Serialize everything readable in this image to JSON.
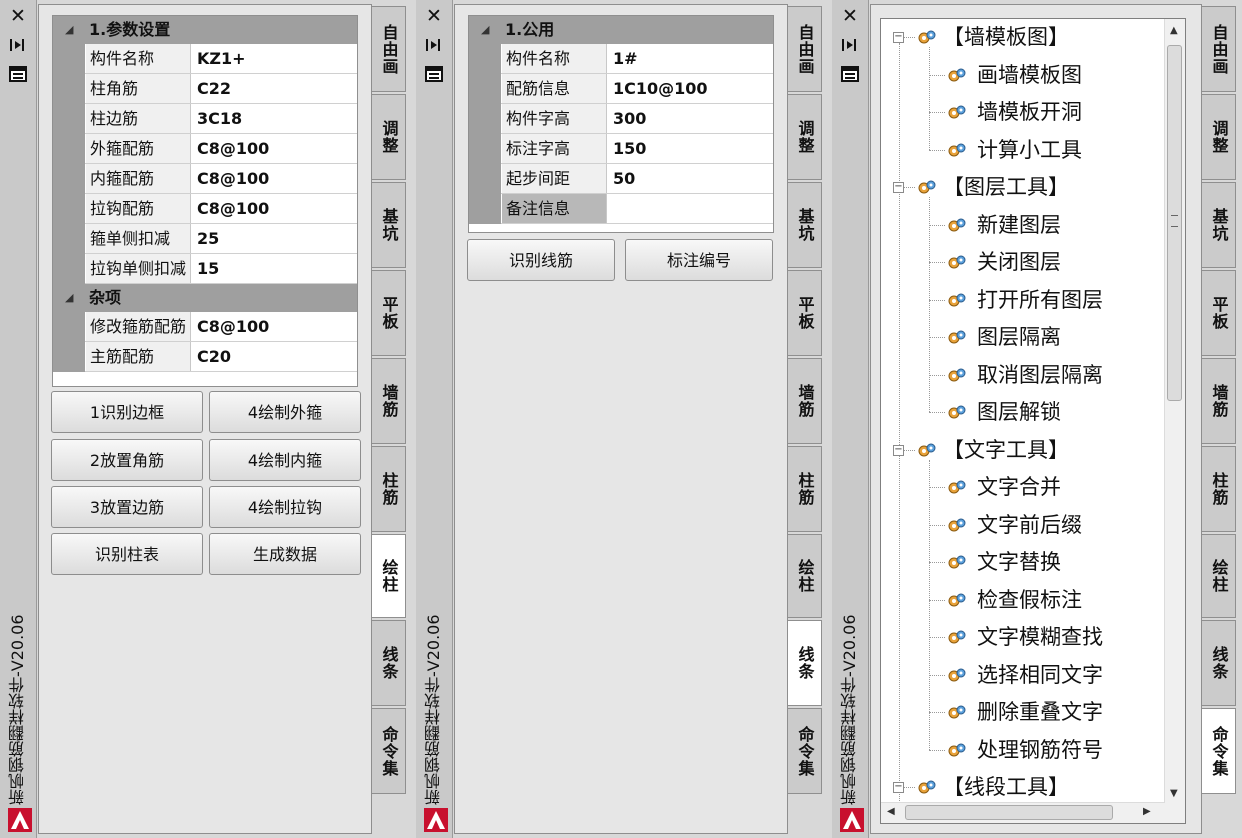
{
  "version_title": "新帆钢筋翻样软件-V20.06",
  "panels": [
    {
      "sections": [
        {
          "title": "1.参数设置",
          "rows": [
            {
              "key": "构件名称",
              "value": "KZ1+"
            },
            {
              "key": "柱角筋",
              "value": "C22"
            },
            {
              "key": "柱边筋",
              "value": "3C18"
            },
            {
              "key": "外箍配筋",
              "value": "C8@100"
            },
            {
              "key": "内箍配筋",
              "value": "C8@100"
            },
            {
              "key": "拉钩配筋",
              "value": "C8@100"
            },
            {
              "key": "箍单侧扣减",
              "value": "25"
            },
            {
              "key": "拉钩单侧扣减",
              "value": "15"
            }
          ]
        },
        {
          "title": "杂项",
          "rows": [
            {
              "key": "修改箍筋配筋",
              "value": "C8@100"
            },
            {
              "key": "主筋配筋",
              "value": "C20"
            }
          ]
        }
      ],
      "buttons": [
        "1识别边框",
        "4绘制外箍",
        "2放置角筋",
        "4绘制内箍",
        "3放置边筋",
        "4绘制拉钩",
        "识别柱表",
        "生成数据"
      ],
      "tabs": [
        "自由画",
        "调整",
        "基坑",
        "平板",
        "墙筋",
        "柱筋",
        "绘柱",
        "线条",
        "命令集"
      ],
      "active_tab": "绘柱"
    },
    {
      "sections": [
        {
          "title": "1.公用",
          "rows": [
            {
              "key": "构件名称",
              "value": "1#"
            },
            {
              "key": "配筋信息",
              "value": "1C10@100"
            },
            {
              "key": "构件字高",
              "value": "300"
            },
            {
              "key": "标注字高",
              "value": "150"
            },
            {
              "key": "起步间距",
              "value": "50"
            },
            {
              "key": "备注信息",
              "value": ""
            }
          ]
        }
      ],
      "buttons": [
        "识别线筋",
        "标注编号"
      ],
      "tabs": [
        "自由画",
        "调整",
        "基坑",
        "平板",
        "墙筋",
        "柱筋",
        "绘柱",
        "线条",
        "命令集"
      ],
      "active_tab": "线条"
    },
    {
      "tree": [
        {
          "label": "【墙模板图】",
          "children": [
            "画墙模板图",
            "墙模板开洞",
            "计算小工具"
          ]
        },
        {
          "label": "【图层工具】",
          "children": [
            "新建图层",
            "关闭图层",
            "打开所有图层",
            "图层隔离",
            "取消图层隔离",
            "图层解锁"
          ]
        },
        {
          "label": "【文字工具】",
          "children": [
            "文字合并",
            "文字前后缀",
            "文字替换",
            "检查假标注",
            "文字模糊查找",
            "选择相同文字",
            "删除重叠文字",
            "处理钢筋符号"
          ]
        },
        {
          "label": "【线段工具】",
          "children": []
        }
      ],
      "tabs": [
        "自由画",
        "调整",
        "基坑",
        "平板",
        "墙筋",
        "柱筋",
        "绘柱",
        "线条",
        "命令集"
      ],
      "active_tab": "命令集"
    }
  ],
  "icons": {
    "close": "close-icon",
    "pin": "pin-icon",
    "menu": "properties-icon",
    "app": "autocad-icon",
    "node": "gear-node-icon"
  }
}
